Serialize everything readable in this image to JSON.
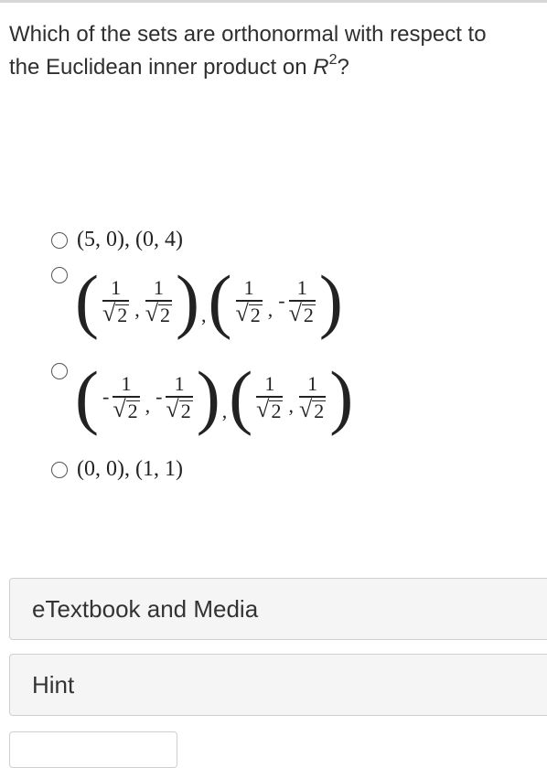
{
  "question": {
    "line1": "Which of the sets are orthonormal with respect to",
    "line2_prefix": "the Euclidean inner product on ",
    "space": "R",
    "exponent": "2",
    "line2_suffix": "?"
  },
  "options": [
    {
      "text": "(5, 0), (0, 4)"
    },
    {
      "vectors": [
        {
          "a_num": "1",
          "a_den": "2",
          "b_num": "1",
          "b_den": "2",
          "a_sign": "",
          "b_sign": ""
        },
        {
          "a_num": "1",
          "a_den": "2",
          "b_num": "1",
          "b_den": "2",
          "a_sign": "",
          "b_sign": "-"
        }
      ]
    },
    {
      "vectors": [
        {
          "a_num": "1",
          "a_den": "2",
          "b_num": "1",
          "b_den": "2",
          "a_sign": "-",
          "b_sign": "-"
        },
        {
          "a_num": "1",
          "a_den": "2",
          "b_num": "1",
          "b_den": "2",
          "a_sign": "",
          "b_sign": ""
        }
      ]
    },
    {
      "text": "(0, 0), (1, 1)"
    }
  ],
  "panels": {
    "etextbook": "eTextbook and Media",
    "hint": "Hint"
  }
}
